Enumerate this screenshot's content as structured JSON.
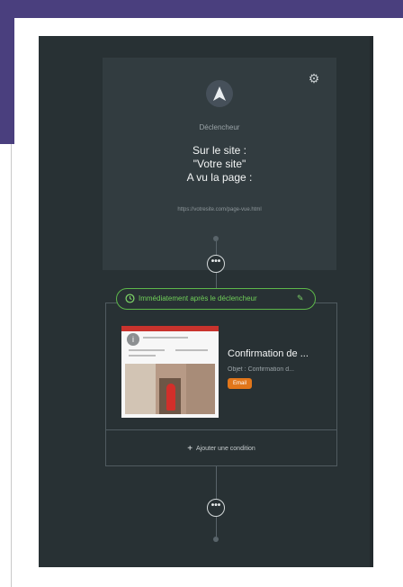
{
  "trigger": {
    "label": "Déclencheur",
    "line1": "Sur le site :",
    "line2": "\"Votre site\"",
    "line3": "A vu la page :",
    "url": "https://votresite.com/page-vue.html",
    "settings_icon": "gear-icon",
    "navigation_icon": "navigation-arrow-icon"
  },
  "connector": {
    "more_label": "•••"
  },
  "timing": {
    "label": "Immédiatement après le déclencheur",
    "clock_icon": "history-clock-icon",
    "edit_icon": "pencil-icon"
  },
  "email_step": {
    "title": "Confirmation de ...",
    "subject": "Objet : Confirmation d...",
    "type_badge": "Email"
  },
  "add_condition": {
    "label": "Ajouter une condition",
    "plus": "+"
  },
  "colors": {
    "canvas": "#283134",
    "card": "#323c40",
    "timing_green": "#5db84a",
    "badge_orange": "#e2761a",
    "header_purple": "#4a3f7e"
  }
}
